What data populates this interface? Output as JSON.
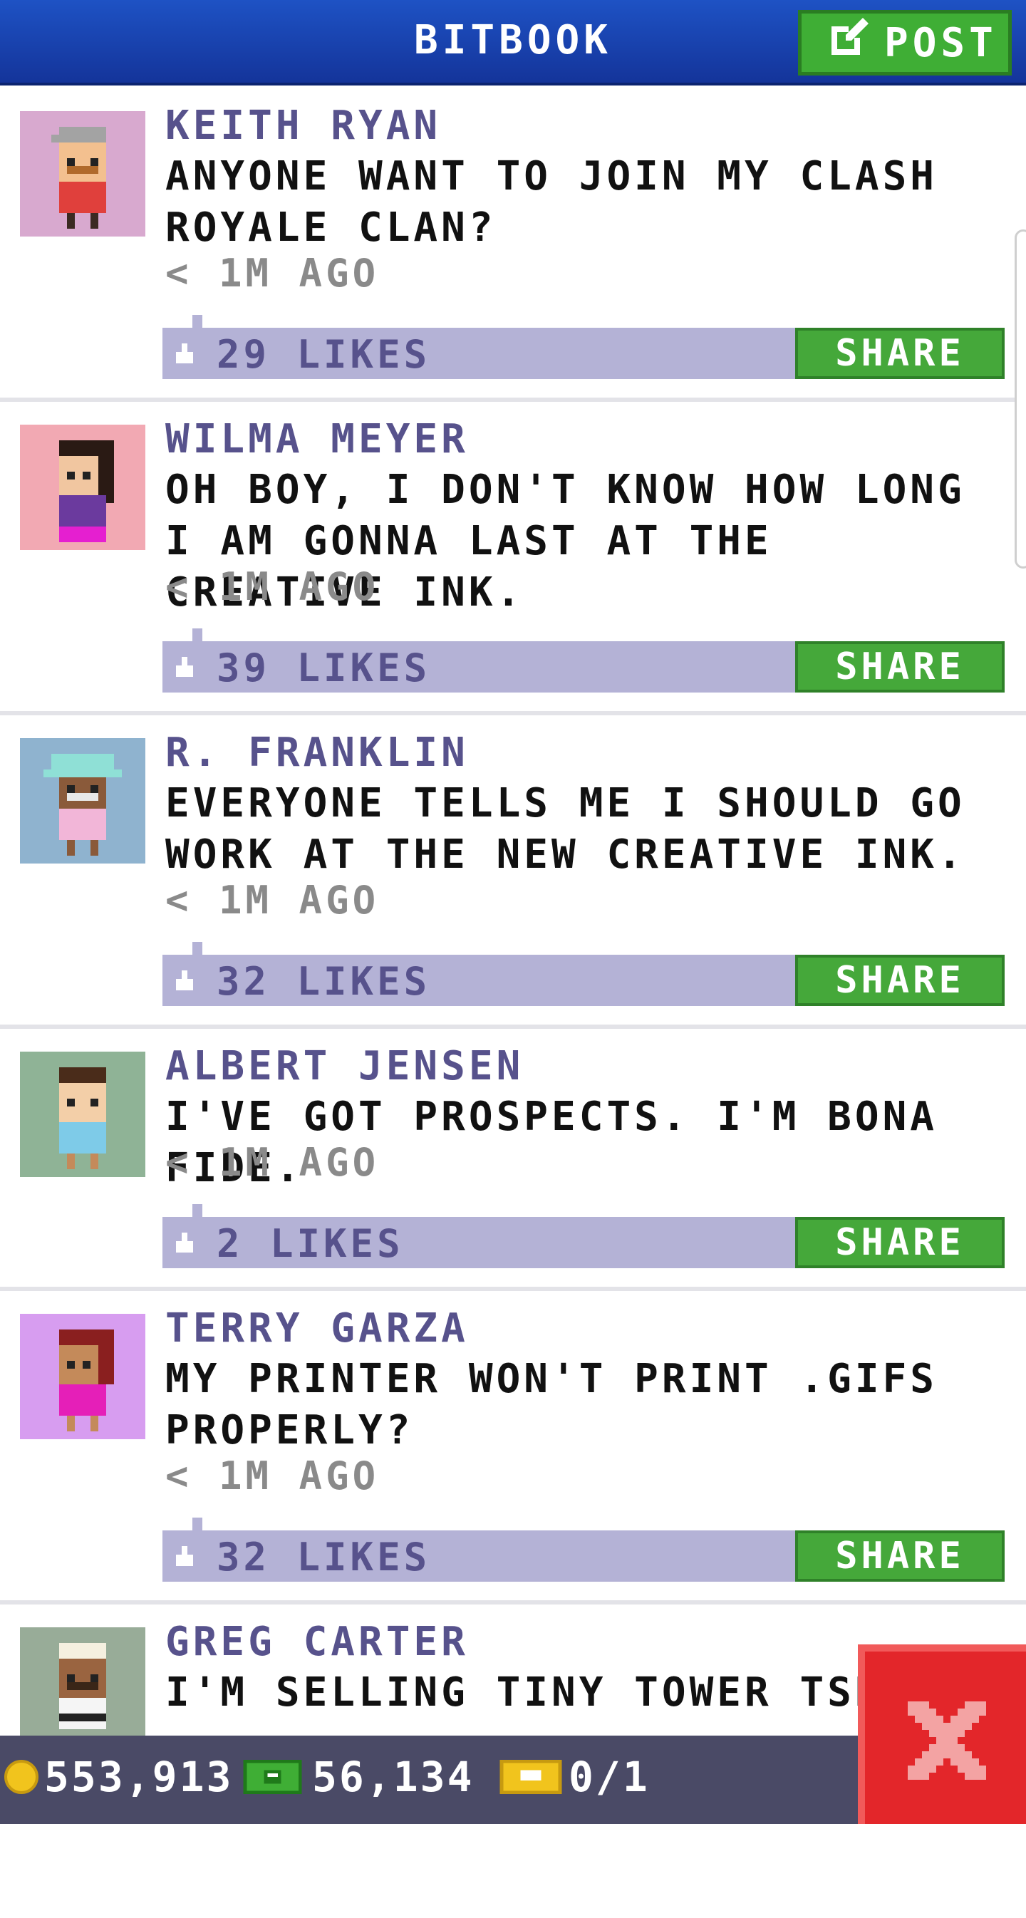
{
  "header": {
    "title": "BITBOOK",
    "post_label": "POST"
  },
  "feed": {
    "posts": [
      {
        "author": "KEITH RYAN",
        "message": "ANYONE WANT TO JOIN MY CLASH ROYALE CLAN?",
        "time": "< 1M AGO",
        "likes": "29 LIKES",
        "share": "SHARE",
        "avatar_bg": "#d8a9cf"
      },
      {
        "author": "WILMA MEYER",
        "message": "OH BOY, I DON'T KNOW HOW LONG I AM GONNA LAST AT THE CREATIVE INK.",
        "time": "< 1M AGO",
        "likes": "39 LIKES",
        "share": "SHARE",
        "avatar_bg": "#f2a9b3"
      },
      {
        "author": "R. FRANKLIN",
        "message": "EVERYONE TELLS ME I SHOULD GO WORK AT THE NEW CREATIVE INK.",
        "time": "< 1M AGO",
        "likes": "32 LIKES",
        "share": "SHARE",
        "avatar_bg": "#8fb3cf"
      },
      {
        "author": "ALBERT JENSEN",
        "message": "I'VE GOT PROSPECTS. I'M BONA FIDE.",
        "time": "< 1M AGO",
        "likes": "2 LIKES",
        "share": "SHARE",
        "avatar_bg": "#8fb396"
      },
      {
        "author": "TERRY GARZA",
        "message": "MY PRINTER WON'T PRINT .GIFS PROPERLY?",
        "time": "< 1M AGO",
        "likes": "32 LIKES",
        "share": "SHARE",
        "avatar_bg": "#d79df0"
      },
      {
        "author": "GREG CARTER",
        "message": "I'M SELLING TINY TOWER TSHIRTS",
        "time": "",
        "likes": "",
        "share": "",
        "avatar_bg": "#98ac98"
      }
    ]
  },
  "bottom_bar": {
    "coins": "553,913",
    "bux": "56,134",
    "tickets": "0/1"
  },
  "colors": {
    "header_blue": "#1e52c4",
    "accent_green": "#45a83a",
    "likes_bar": "#b4b2d6",
    "author_purple": "#57528c",
    "close_red": "#e3262a"
  },
  "icons": {
    "post": "edit-icon",
    "like": "thumbs-up-icon",
    "coin": "coin-icon",
    "bux": "cash-icon",
    "ticket": "ticket-icon",
    "close": "close-icon"
  }
}
